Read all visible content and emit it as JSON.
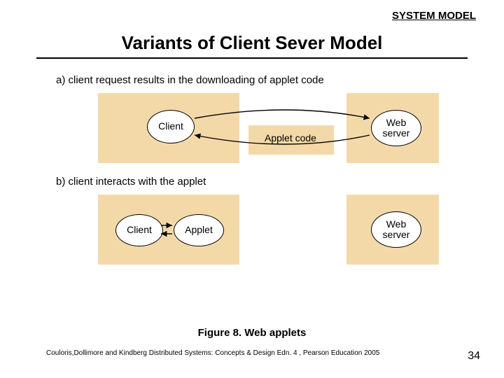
{
  "header": {
    "label": "SYSTEM MODEL"
  },
  "title": "Variants of Client Sever Model",
  "diagram": {
    "a": {
      "caption": "a) client request results in the downloading of applet code",
      "client": "Client",
      "mid": "Applet code",
      "server": "Web\nserver"
    },
    "b": {
      "caption": "b) client  interacts with the applet",
      "client": "Client",
      "applet": "Applet",
      "server": "Web\nserver"
    }
  },
  "figure_caption": "Figure 8. Web applets",
  "citation": "Couloris,Dollimore and Kindberg  Distributed Systems: Concepts & Design  Edn. 4 , Pearson Education 2005",
  "page": "34"
}
